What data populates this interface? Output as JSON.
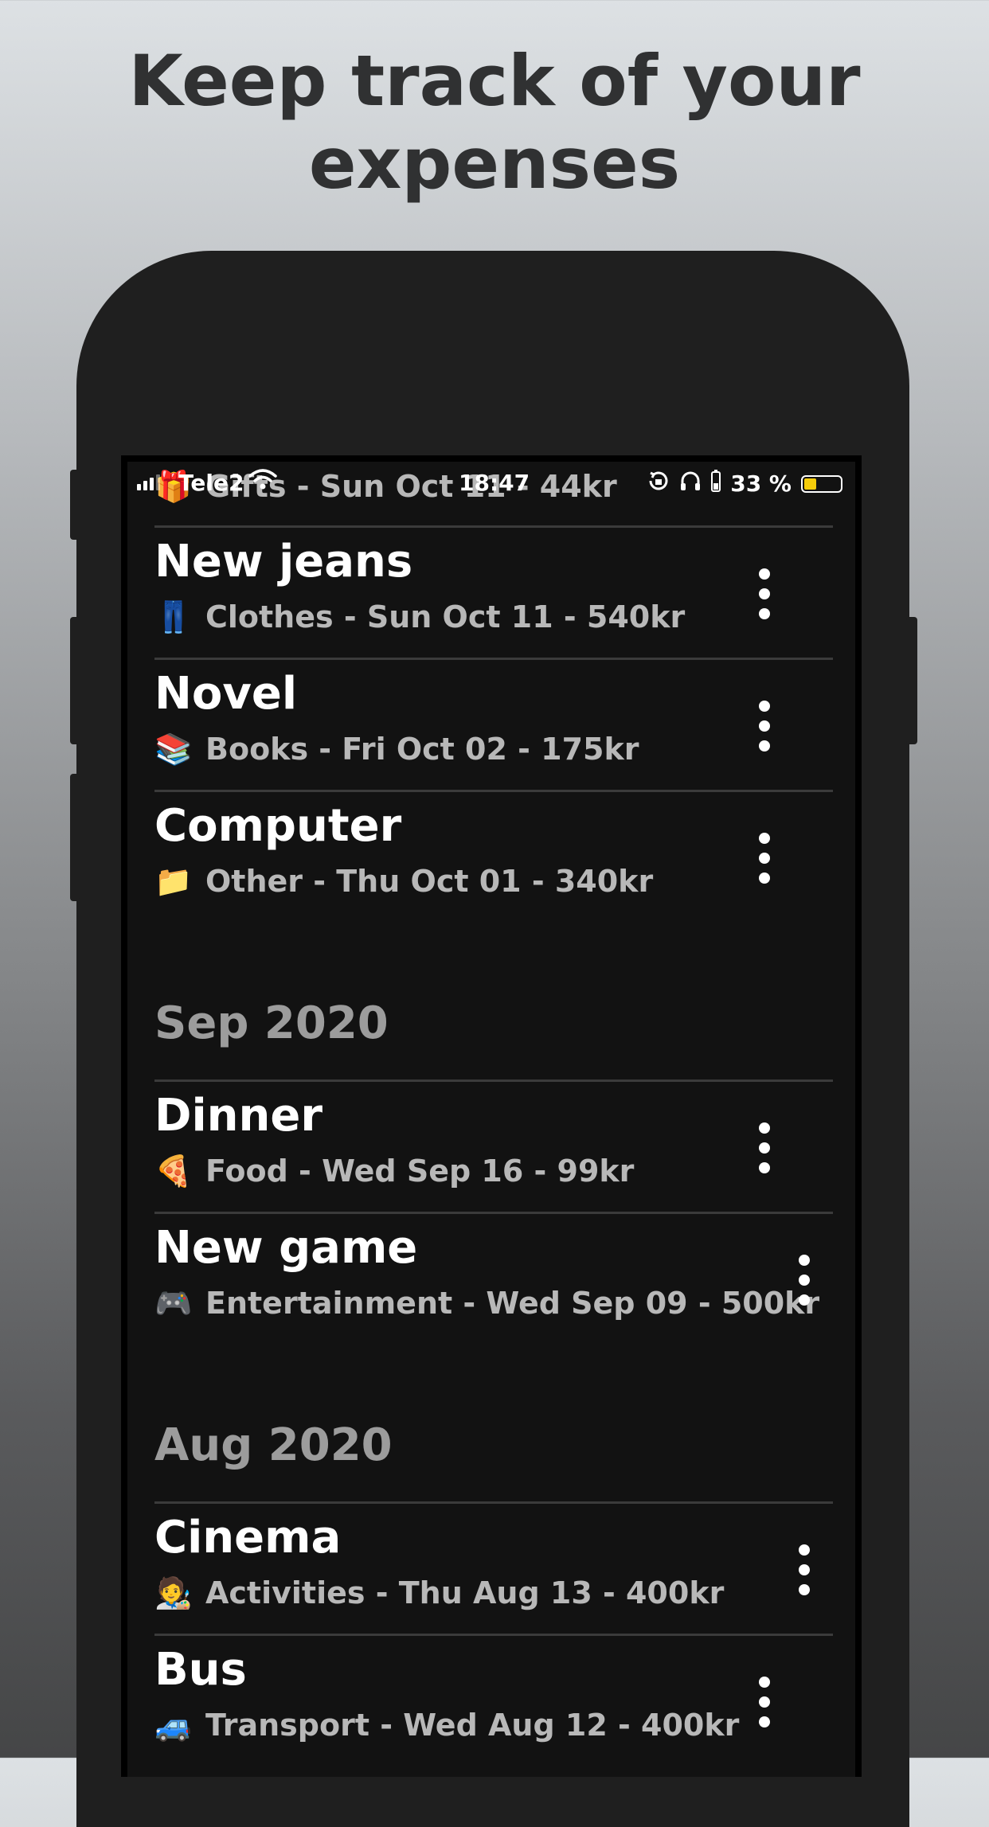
{
  "headline": {
    "line1": "Keep track of your",
    "line2": "expenses"
  },
  "status_bar": {
    "carrier": "Tele2",
    "time": "18:47",
    "battery_percent": "33 %",
    "battery_level": 0.33,
    "battery_color": "#f5cc0a"
  },
  "partial_row": {
    "emoji": "🎁",
    "subtitle": "Gifts - Sun Oct 11 - 44kr"
  },
  "sections": [
    {
      "header": "",
      "items": [
        {
          "title": "New jeans",
          "emoji": "👖",
          "subtitle": "Clothes - Sun Oct 11 - 540kr"
        },
        {
          "title": "Novel",
          "emoji": "📚",
          "subtitle": "Books - Fri Oct 02 - 175kr"
        },
        {
          "title": "Computer",
          "emoji": "📁",
          "subtitle": "Other - Thu Oct 01 - 340kr"
        }
      ]
    },
    {
      "header": "Sep 2020",
      "items": [
        {
          "title": "Dinner",
          "emoji": "🍕",
          "subtitle": "Food - Wed Sep 16 - 99kr"
        },
        {
          "title": "New game",
          "emoji": "🎮",
          "subtitle": "Entertainment - Wed Sep 09 - 500kr"
        }
      ]
    },
    {
      "header": "Aug 2020",
      "items": [
        {
          "title": "Cinema",
          "emoji": "🧑‍🎨",
          "subtitle": "Activities - Thu Aug 13 - 400kr"
        },
        {
          "title": "Bus",
          "emoji": "🚙",
          "subtitle": "Transport - Wed Aug 12 - 400kr"
        }
      ]
    }
  ],
  "icons": {
    "more": "more-vertical-icon",
    "wifi": "wifi-icon",
    "signal": "signal-icon",
    "rotation_lock": "rotation-lock-icon",
    "headphones": "headphones-icon"
  }
}
